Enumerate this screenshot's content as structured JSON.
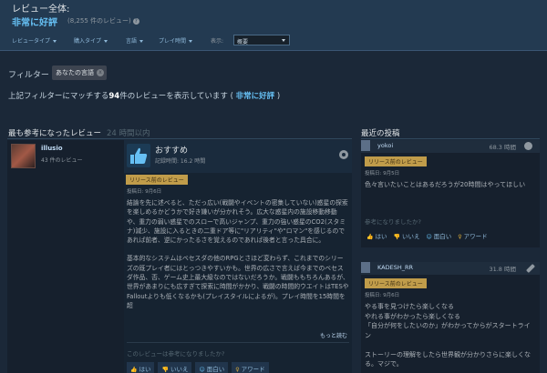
{
  "summary": {
    "title": "レビュー全体:",
    "rating": "非常に好評",
    "count": "(8,255 件のレビュー)"
  },
  "filters": {
    "dropdowns": [
      "レビュータイプ",
      "購入タイプ",
      "言語",
      "プレイ時間"
    ],
    "display_label": "表示:",
    "display_value": "概要"
  },
  "active_filter": {
    "label": "フィルター",
    "chip": "あなたの言語",
    "chip_close": "x"
  },
  "match_line": {
    "prefix": "上記フィルターにマッチする",
    "count": "94",
    "middle": "件のレビューを表示しています (",
    "rating": "非常に好評",
    "suffix": ")"
  },
  "section": {
    "title": "最も参考になったレビュー",
    "sub": "24 時間以内"
  },
  "review": {
    "author": "illusio",
    "author_reviews": "43 件のレビュー",
    "verdict": "おすすめ",
    "playtime": "記録時間: 16.2 時間",
    "tag": "リリース前のレビュー",
    "posted": "投稿日: 9月6日",
    "body": [
      "結論を先に述べると、ただっ広い(戦闘やイベントの密集していない)惑星の探索を楽しめるかどうかで好き嫌いが分かれそう。広大な惑星内の施設移動移動や、重力の弱い惑星でのスローで高いジャンプ、重力の強い惑星のCO2(スタミナ)減少、施設に入るときの二重ドア等に\"リアリティ\"や\"ロマン\"を感じるのであれば前者、逆にかったるさを覚えるのであれば後者と言った具合に。",
      "基本的なシステムはベセスダの他のRPGとさほど変わらず、これまでのシリーズの既プレイ者にはとっつきやすいかも。世界の広さで言えば今までのベセスダ作品、否、ゲーム史上最大級なのではないだろうか。戦闘ももちろんあるが、世界があまりにも広すぎて探索に時間がかかり、戦闘の時間的ウエイトはTESやFalloutよりも低くなるかも(プレイスタイルによるが)。プレイ時間を15時間を超"
    ],
    "read_more": "もっと読む",
    "helpful_q": "このレビューは参考になりましたか?",
    "votes": [
      "はい",
      "いいえ",
      "面白い",
      "アワード"
    ]
  },
  "recent": {
    "title": "最近の投稿",
    "posts": [
      {
        "author": "yokoi",
        "hours": "68.3 時間",
        "tag": "リリース前のレビュー",
        "date": "投稿日: 9月5日",
        "text": "色々言いたいことはあるだろうが20時間はやってほしい",
        "q": "参考になりましたか?",
        "votes": [
          "はい",
          "いいえ",
          "面白い",
          "アワード"
        ]
      },
      {
        "author": "KADESH_RR",
        "hours": "31.8 時間",
        "tag": "リリース前のレビュー",
        "date": "投稿日: 9月6日",
        "text": "やる事を見つけたら楽しくなる\nやれる事がわかったら楽しくなる\n「自分が何をしたいのか」がわかってからがスタートライン\n\nストーリーの理解をしたら世界観が分かりさらに楽しくなる。マジで。"
      }
    ]
  },
  "colors": {
    "background": "#1b2838",
    "accent": "#66c0f4",
    "tag": "#c09c4a"
  },
  "icons": [
    "help-icon",
    "caret-down-icon",
    "close-icon",
    "thumbs-up-icon",
    "steam-icon",
    "thumbs-down-icon",
    "laugh-icon",
    "award-icon",
    "wrench-icon"
  ]
}
